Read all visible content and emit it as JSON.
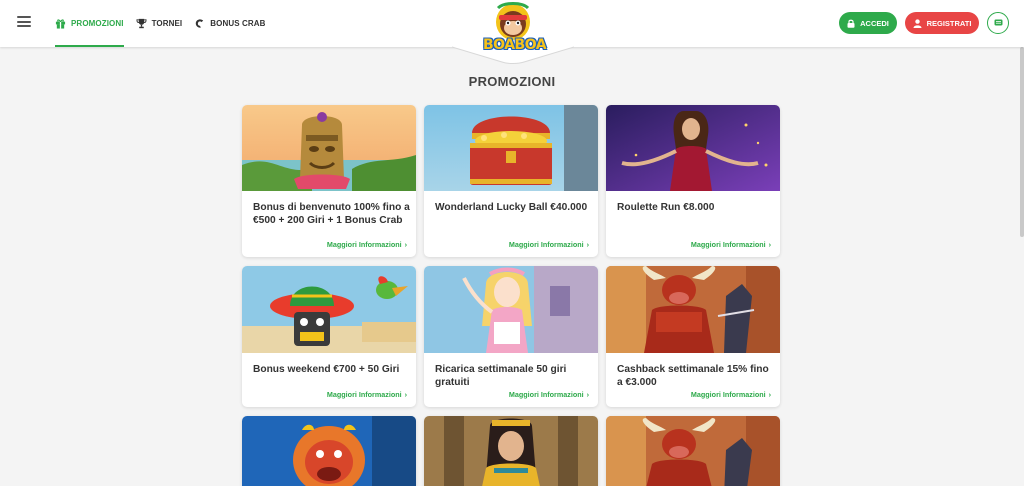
{
  "header": {
    "nav": [
      {
        "label": "PROMOZIONI",
        "icon": "gift-icon",
        "active": true
      },
      {
        "label": "TORNEI",
        "icon": "trophy-icon",
        "active": false
      },
      {
        "label": "BONUS CRAB",
        "icon": "crab-claw-icon",
        "active": false
      }
    ],
    "logo_text": "BOABOA",
    "login_label": "ACCEDI",
    "register_label": "REGISTRATI"
  },
  "page_title": "PROMOZIONI",
  "more_label": "Maggiori Informazioni",
  "cards": [
    {
      "title": "Bonus di benvenuto 100% fino a €500 + 200 Giri + 1 Bonus Crab",
      "image": "tiki-totem"
    },
    {
      "title": "Wonderland Lucky Ball €40.000",
      "image": "treasure-chest"
    },
    {
      "title": "Roulette Run €8.000",
      "image": "roulette-dealer"
    },
    {
      "title": "Bonus weekend €700 + 50 Giri",
      "image": "sombrero-slot"
    },
    {
      "title": "Ricarica settimanale 50 giri gratuiti",
      "image": "anime-girl"
    },
    {
      "title": "Cashback settimanale 15% fino a €3.000",
      "image": "bull-matador"
    },
    {
      "title": "",
      "image": "red-lion"
    },
    {
      "title": "",
      "image": "egyptian-queen"
    },
    {
      "title": "",
      "image": "bull-matador"
    }
  ],
  "colors": {
    "accent": "#2eaa4b",
    "register": "#e84545",
    "background": "#f4f4f4"
  }
}
